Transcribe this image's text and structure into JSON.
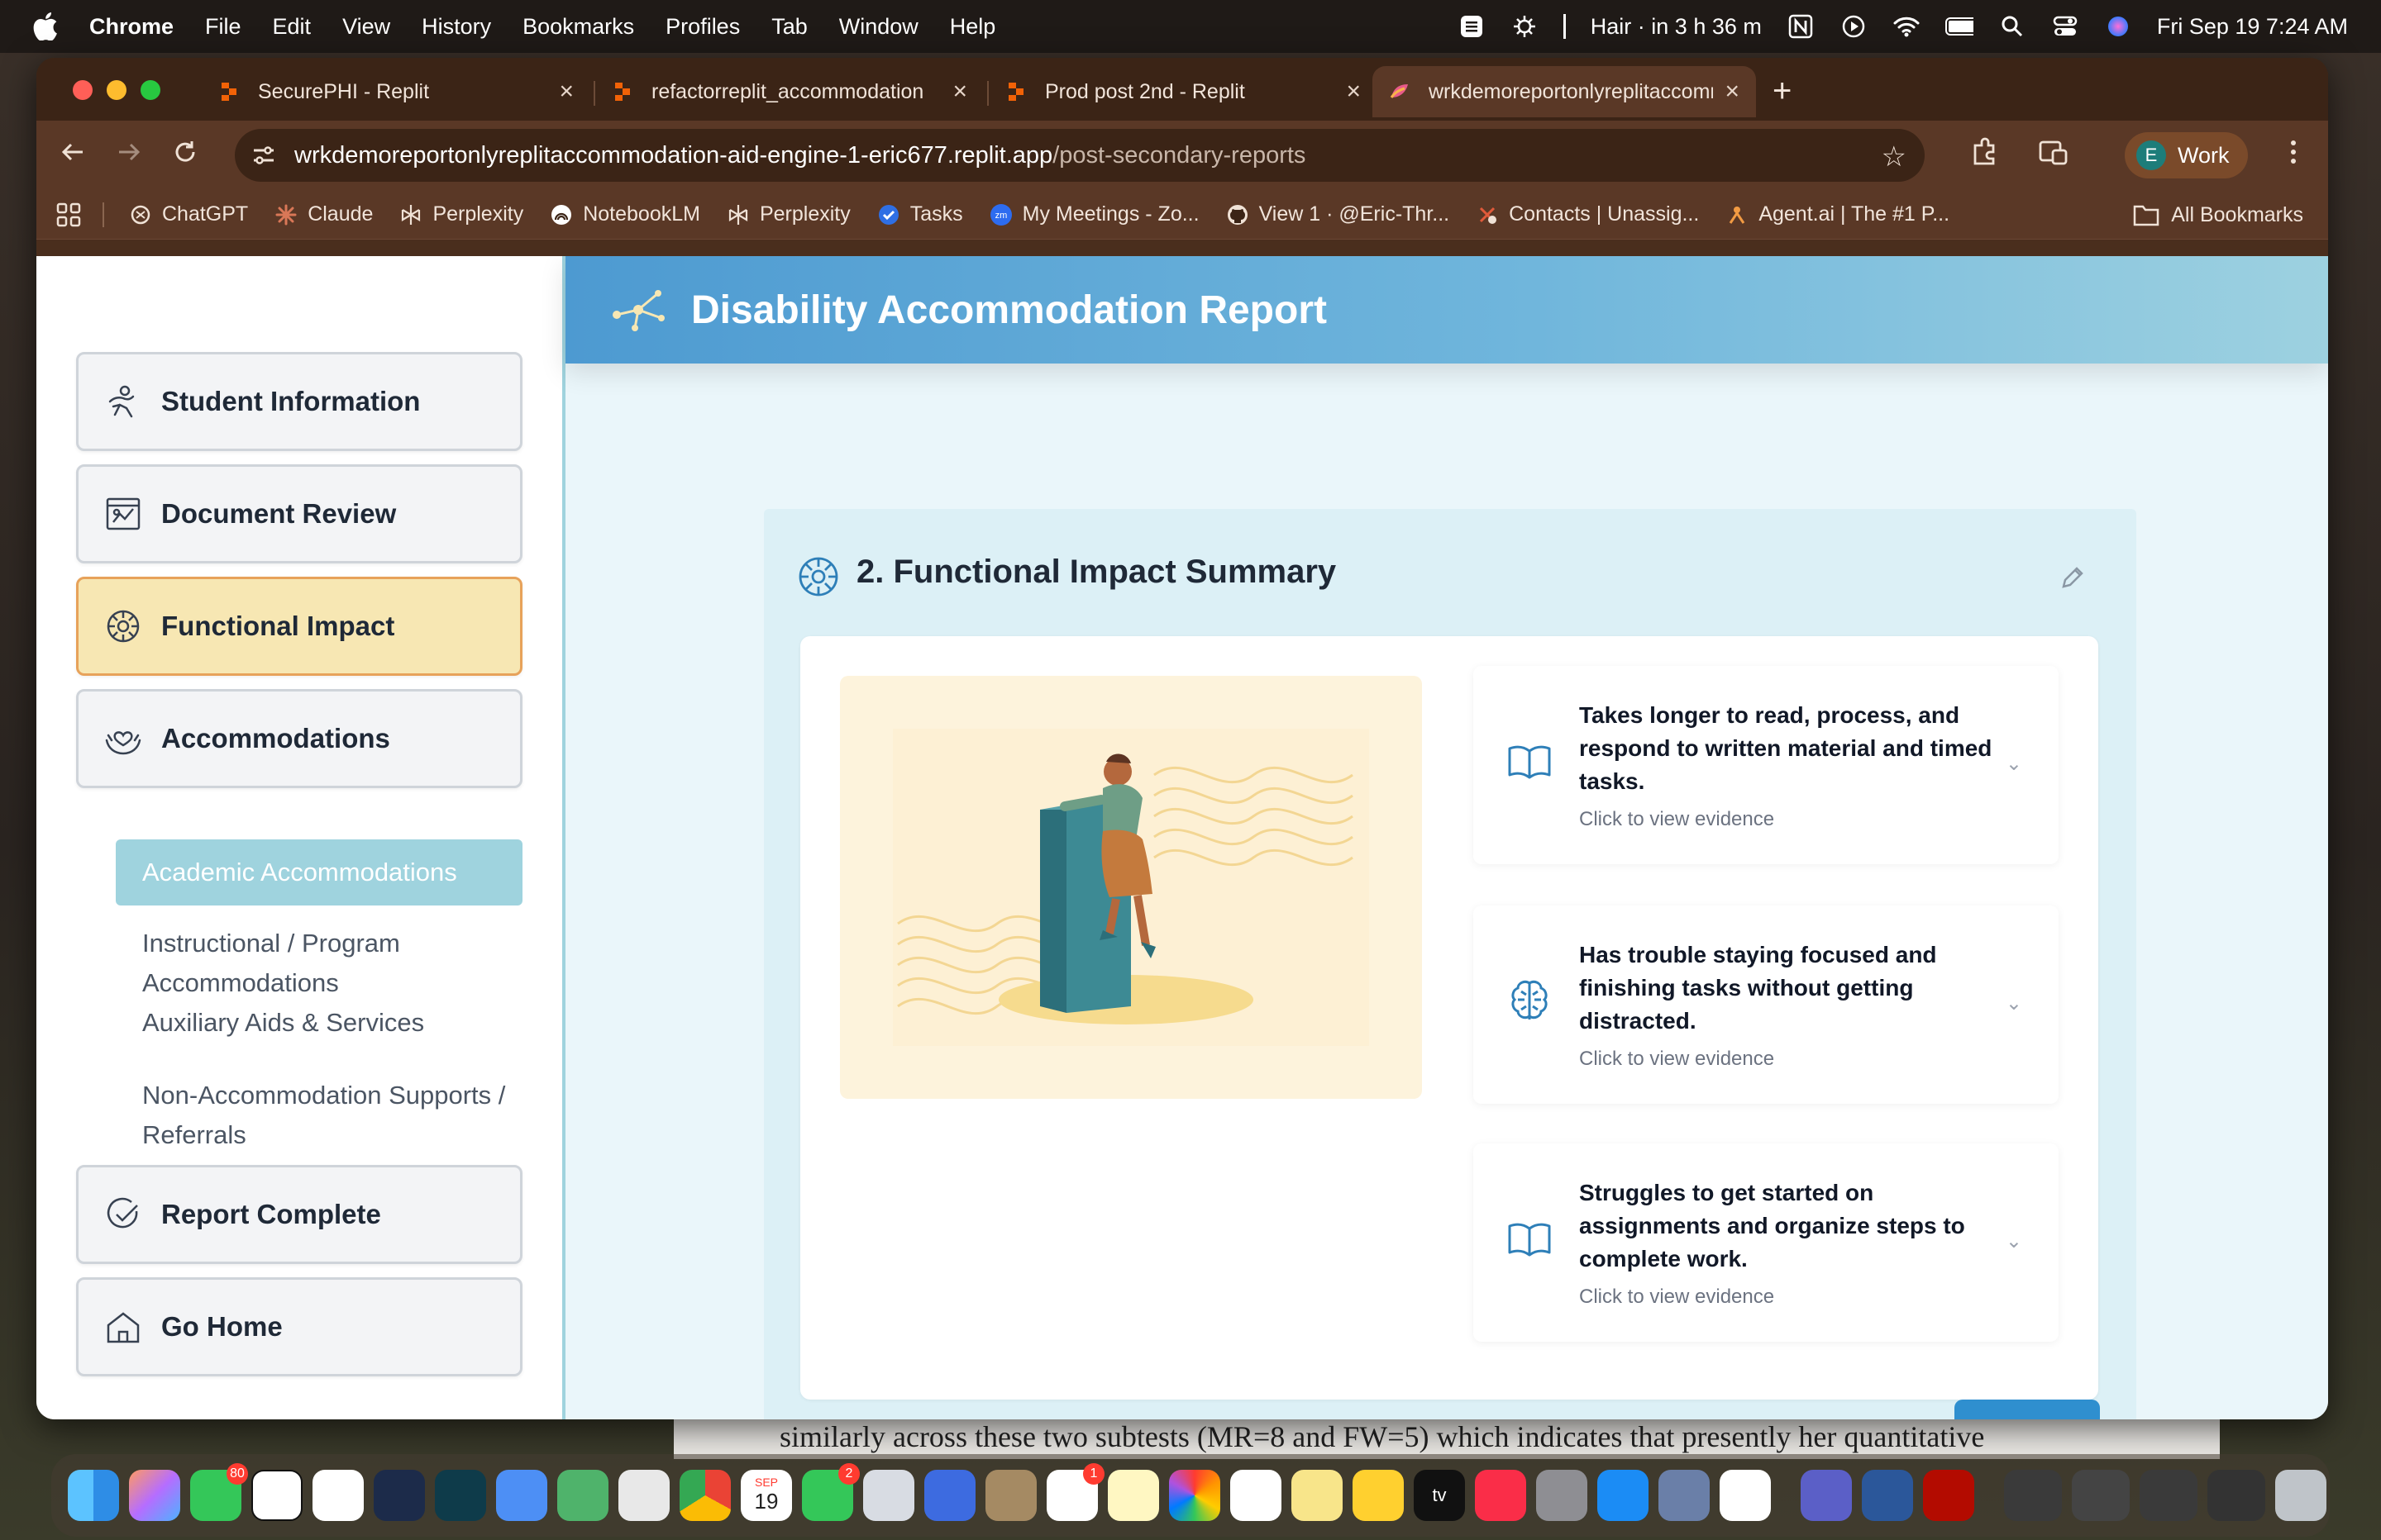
{
  "menubar": {
    "app": "Chrome",
    "items": [
      "File",
      "Edit",
      "View",
      "History",
      "Bookmarks",
      "Profiles",
      "Tab",
      "Window",
      "Help"
    ],
    "event": "Hair · in 3 h 36 m",
    "datetime": "Fri Sep 19  7:24 AM"
  },
  "tabs": [
    {
      "title": "SecurePHI - Replit",
      "close": "×"
    },
    {
      "title": "refactorreplit_accommodation",
      "close": "×"
    },
    {
      "title": "Prod post 2nd - Replit",
      "close": "×"
    },
    {
      "title": "wrkdemoreportonlyreplitaccommodation",
      "close": "×"
    }
  ],
  "new_tab": "+",
  "address": {
    "host": "wrkdemoreportonlyreplitaccommodation-aid-engine-1-eric677.replit.app",
    "path": "/post-secondary-reports"
  },
  "profile": {
    "initial": "E",
    "name": "Work"
  },
  "bookmarks": [
    {
      "label": "ChatGPT"
    },
    {
      "label": "Claude"
    },
    {
      "label": "Perplexity"
    },
    {
      "label": "NotebookLM"
    },
    {
      "label": "Perplexity"
    },
    {
      "label": "Tasks"
    },
    {
      "label": "My Meetings - Zo..."
    },
    {
      "label": "View 1 · @Eric-Thr..."
    },
    {
      "label": "Contacts | Unassig..."
    },
    {
      "label": "Agent.ai | The #1 P..."
    }
  ],
  "all_bookmarks": "All Bookmarks",
  "header": {
    "title": "Disability Accommodation Report"
  },
  "sidebar": {
    "student_information": "Student Information",
    "document_review": "Document Review",
    "functional_impact": "Functional Impact",
    "accommodations": "Accommodations",
    "sub_items": [
      "Academic Accommodations",
      "Instructional / Program Accommodations",
      "Auxiliary Aids & Services",
      "Non-Accommodation Supports / Referrals"
    ],
    "report_complete": "Report Complete",
    "go_home": "Go Home"
  },
  "section": {
    "title": "2. Functional Impact Summary",
    "impacts": [
      {
        "text": "Takes longer to read, process, and respond to written material and timed tasks.",
        "evidence": "Click to view evidence",
        "icon": "book-icon"
      },
      {
        "text": "Has trouble staying focused and finishing tasks without getting distracted.",
        "evidence": "Click to view evidence",
        "icon": "brain-icon"
      },
      {
        "text": "Struggles to get started on assignments and organize steps to complete work.",
        "evidence": "Click to view evidence",
        "icon": "book-icon"
      }
    ]
  },
  "background_doc_text": "similarly across these two subtests (MR=8 and FW=5) which indicates that presently her quantitative",
  "dock": {
    "badges": {
      "messages": "80",
      "facetime": "2",
      "reminders": "1"
    },
    "calendar_month": "SEP",
    "calendar_day": "19",
    "tv_label": "tv"
  },
  "colors": {
    "header_gradient_start": "#4d9ad1",
    "header_gradient_end": "#9dd1e0",
    "active_nav_bg": "#f7e7b3",
    "active_nav_border": "#e7a25a",
    "sub_active_bg": "#9fd3de",
    "card_bg": "#dcf0f6",
    "icon_blue": "#2e7fb8"
  }
}
